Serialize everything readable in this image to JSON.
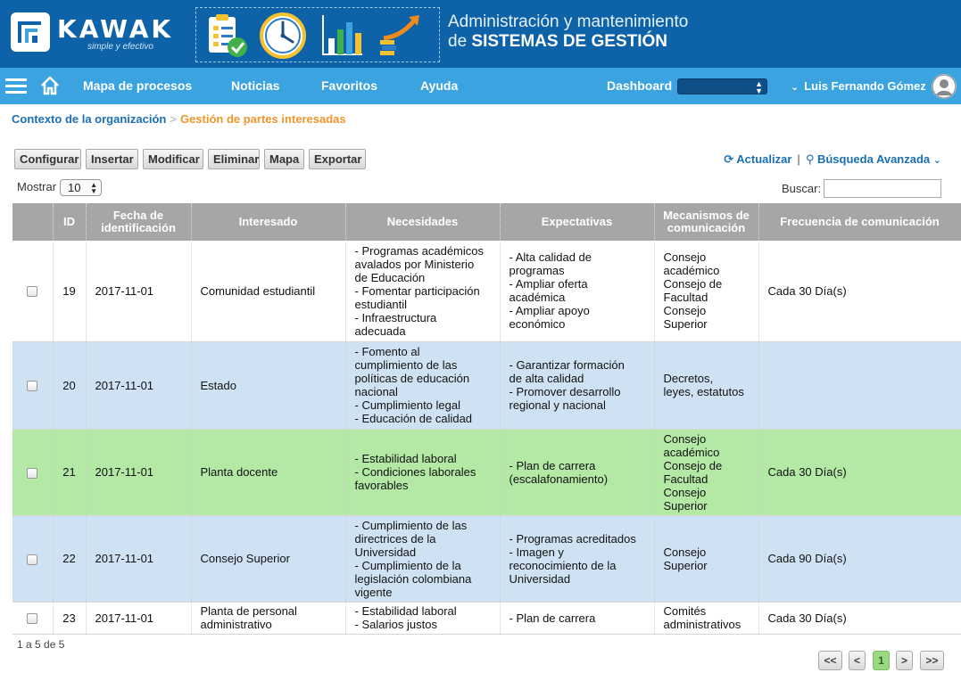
{
  "brand": {
    "name": "KAWAK",
    "tagline": "simple y efectivo",
    "title_line1": "Administración y mantenimiento",
    "title_line2_prefix": "de",
    "title_line2_bold": "SISTEMAS DE GESTIÓN"
  },
  "nav": {
    "items": [
      "Mapa de procesos",
      "Noticias",
      "Favoritos",
      "Ayuda"
    ],
    "dashboard_label": "Dashboard",
    "dashboard_value": "",
    "user_name": "Luis Fernando Gómez"
  },
  "breadcrumb": {
    "parent": "Contexto de la organización",
    "separator": ">",
    "current": "Gestión de partes interesadas"
  },
  "toolbar": {
    "buttons": [
      "Configurar",
      "Insertar",
      "Modificar",
      "Eliminar",
      "Mapa",
      "Exportar"
    ],
    "refresh_label": "Actualizar",
    "advanced_search_label": "Búsqueda Avanzada"
  },
  "list_controls": {
    "show_label": "Mostrar",
    "show_value": "10",
    "search_label": "Buscar:",
    "search_value": ""
  },
  "table": {
    "headers": [
      "ID",
      "Fecha de identificación",
      "Interesado",
      "Necesidades",
      "Expectativas",
      "Mecanismos de comunicación",
      "Frecuencia de comunicación"
    ],
    "rows": [
      {
        "id": "19",
        "date": "2017-11-01",
        "stakeholder": "Comunidad estudiantil",
        "needs": [
          "- Programas académicos",
          "avalados por Ministerio",
          "de Educación",
          "- Fomentar participación",
          "estudiantil",
          "- Infraestructura",
          "adecuada"
        ],
        "expectations": [
          "- Alta calidad de",
          "programas",
          "- Ampliar oferta",
          "académica",
          "- Ampliar apoyo",
          "económico"
        ],
        "mechanisms": [
          "Consejo",
          "académico",
          "Consejo de",
          "Facultad",
          "Consejo",
          "Superior"
        ],
        "frequency": "Cada 30 Día(s)"
      },
      {
        "id": "20",
        "date": "2017-11-01",
        "stakeholder": "Estado",
        "needs": [
          "- Fomento al",
          "cumplimiento de las",
          "políticas de educación",
          "nacional",
          "- Cumplimiento legal",
          "- Educación de calidad"
        ],
        "expectations": [
          "- Garantizar formación",
          "de alta calidad",
          "- Promover desarrollo",
          "regional y nacional"
        ],
        "mechanisms": [
          "Decretos,",
          "leyes, estatutos"
        ],
        "frequency": ""
      },
      {
        "id": "21",
        "date": "2017-11-01",
        "stakeholder": "Planta docente",
        "needs": [
          "- Estabilidad laboral",
          "- Condiciones laborales",
          "favorables"
        ],
        "expectations": [
          "- Plan de carrera",
          "(escalafonamiento)"
        ],
        "mechanisms": [
          "Consejo",
          "académico",
          "Consejo de",
          "Facultad",
          "Consejo",
          "Superior"
        ],
        "frequency": "Cada 30 Día(s)"
      },
      {
        "id": "22",
        "date": "2017-11-01",
        "stakeholder": "Consejo Superior",
        "needs": [
          "- Cumplimiento de las",
          "directrices de la",
          "Universidad",
          "- Cumplimiento de la",
          "legislación colombiana",
          "vigente"
        ],
        "expectations": [
          "- Programas acreditados",
          "- Imagen y",
          "reconocimiento de la",
          "Universidad"
        ],
        "mechanisms": [
          "Consejo",
          "Superior"
        ],
        "frequency": "Cada 90 Día(s)"
      },
      {
        "id": "23",
        "date": "2017-11-01",
        "stakeholder": "Planta de personal administrativo",
        "needs": [
          "- Estabilidad laboral",
          "- Salarios justos"
        ],
        "expectations": [
          "- Plan de carrera"
        ],
        "mechanisms": [
          "Comités",
          "administrativos"
        ],
        "frequency": "Cada 30 Día(s)"
      }
    ]
  },
  "footer": {
    "count_text": "1 a 5 de 5",
    "pager": [
      "<<",
      "<",
      "1",
      ">",
      ">>"
    ],
    "current_page": "1"
  },
  "colors": {
    "banner": "#0d62a8",
    "navbar": "#3ba3e0",
    "row_blue": "#cfe2f3",
    "row_green": "#b3e8a5",
    "breadcrumb_current": "#f0962a"
  }
}
